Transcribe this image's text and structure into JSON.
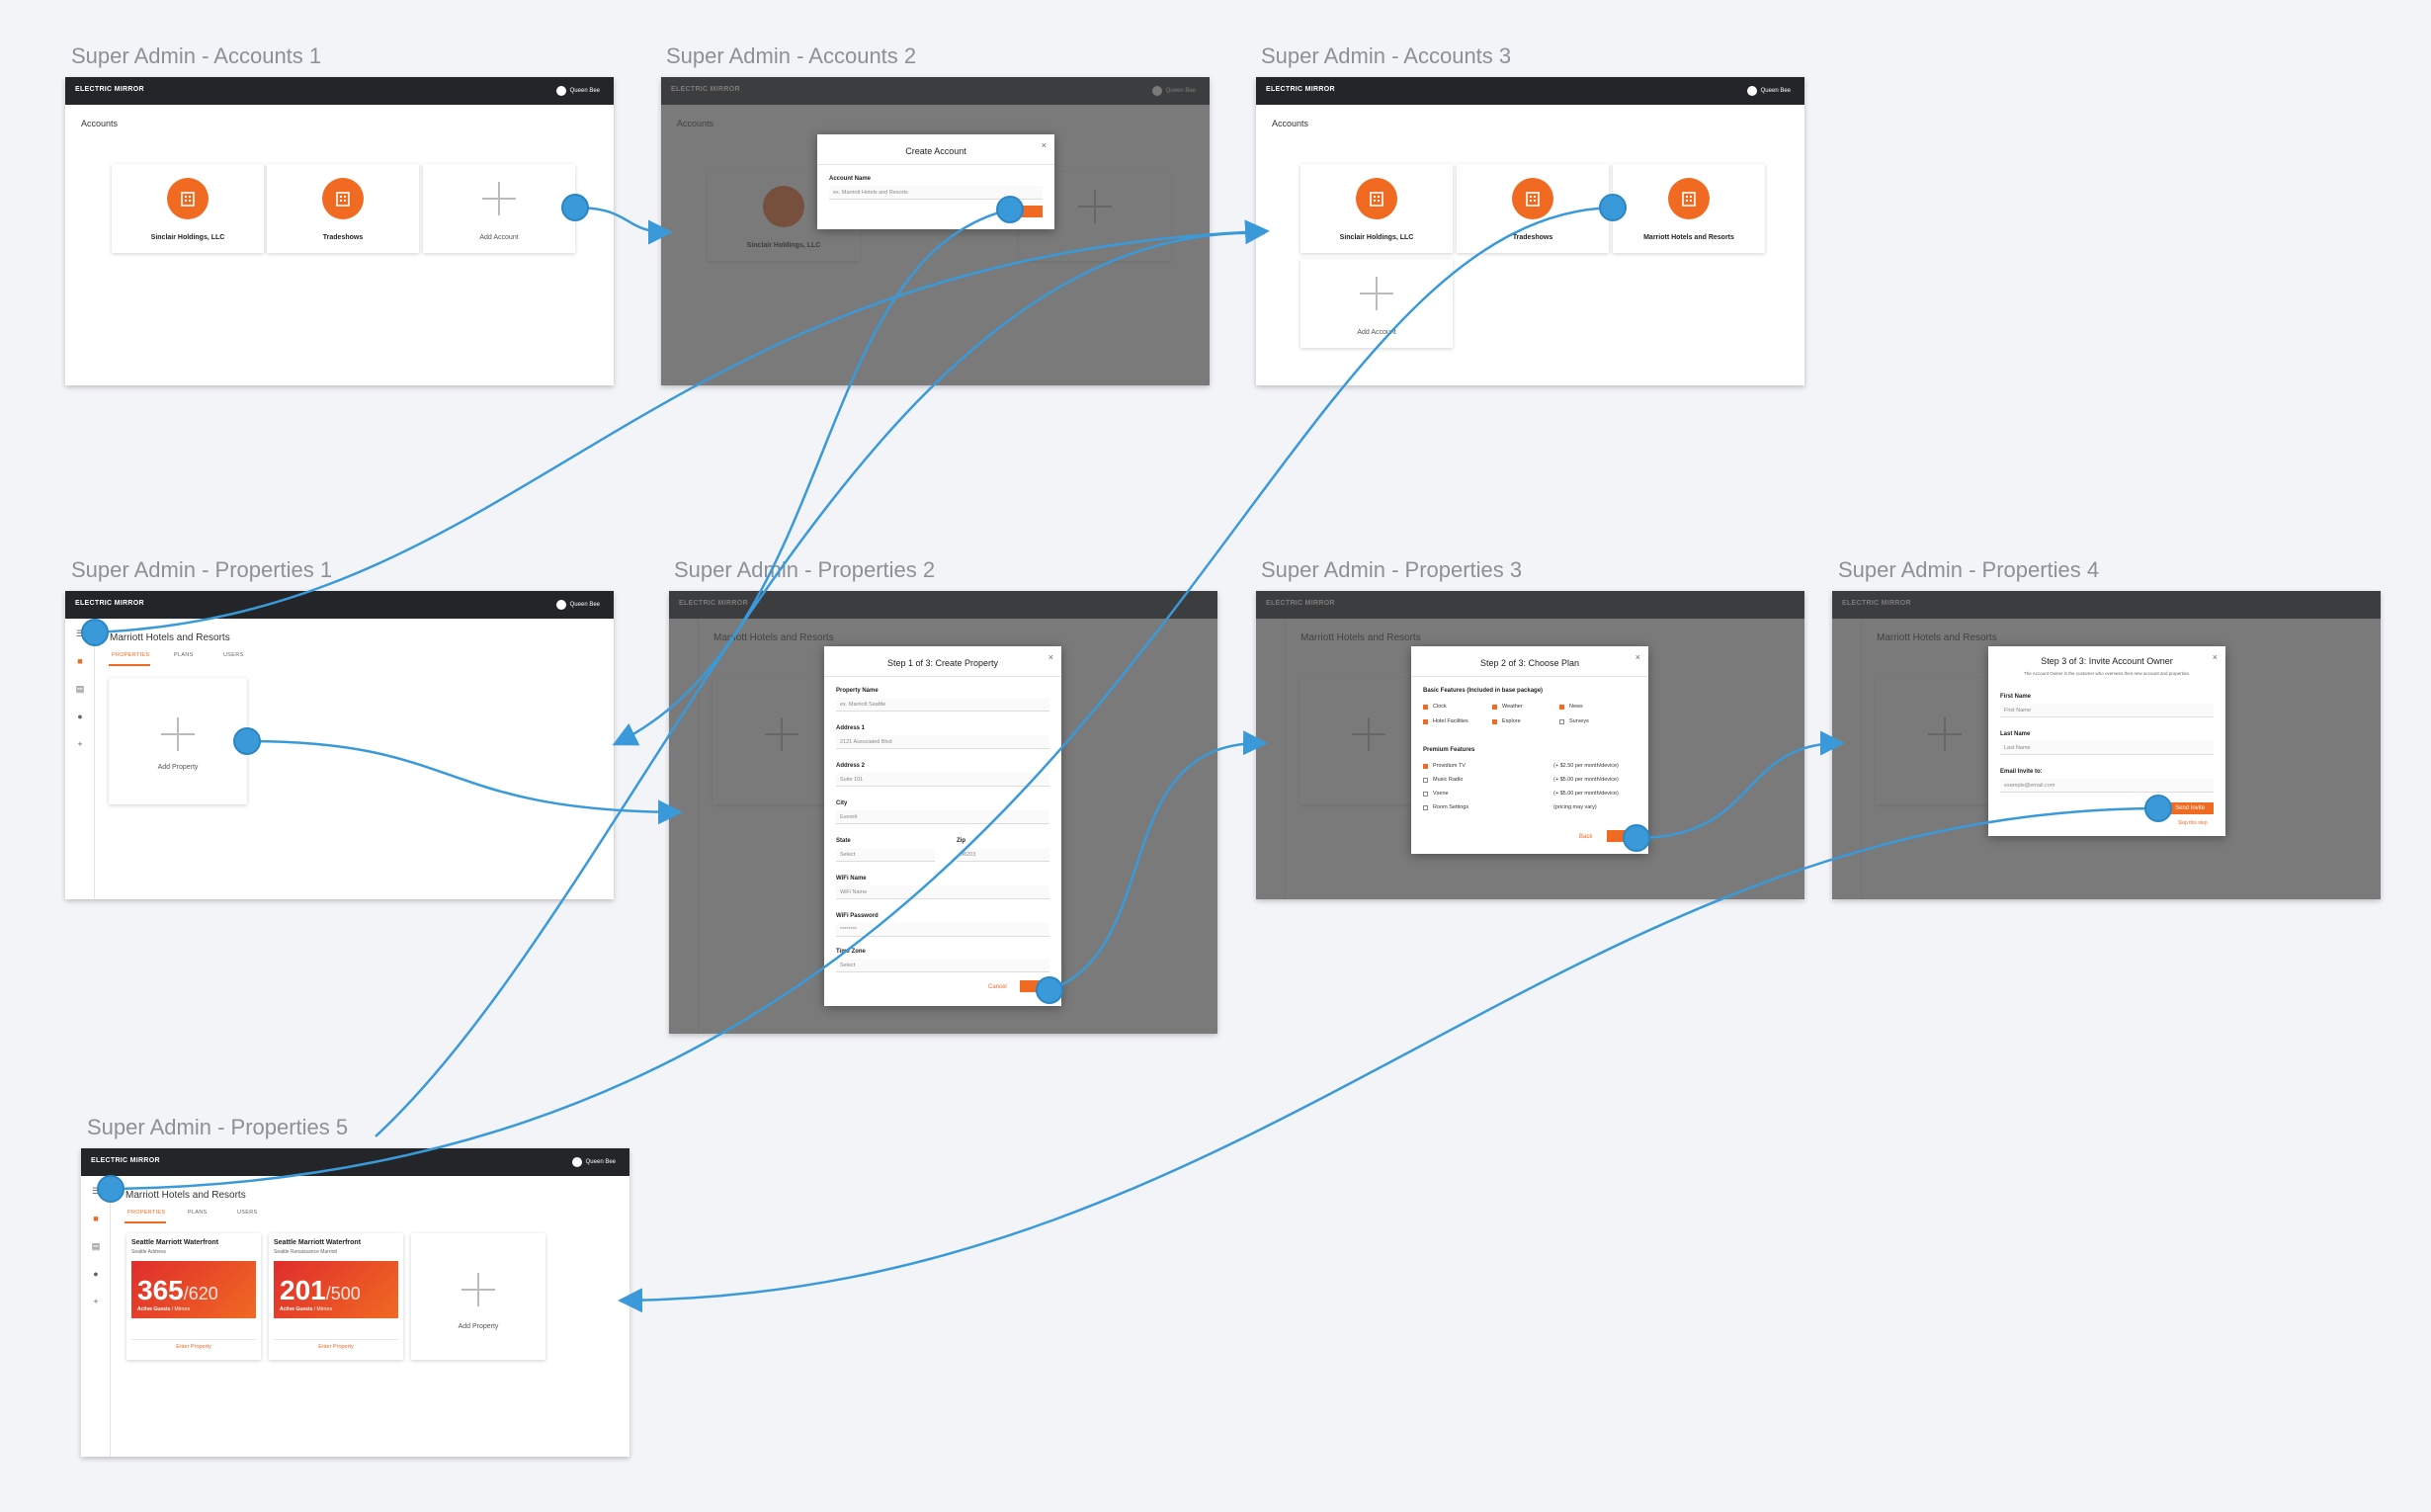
{
  "brand": "ELECTRIC MIRROR",
  "user_name": "Queen Bee",
  "frames": {
    "acc1": "Super Admin - Accounts 1",
    "acc2": "Super Admin - Accounts 2",
    "acc3": "Super Admin - Accounts 3",
    "prop1": "Super Admin - Properties 1",
    "prop2": "Super Admin - Properties 2",
    "prop3": "Super Admin - Properties 3",
    "prop4": "Super Admin - Properties 4",
    "prop5": "Super Admin - Properties 5"
  },
  "accounts": {
    "heading": "Accounts",
    "items": [
      "Sinclair Holdings, LLC",
      "Tradeshows",
      "Marriott Hotels and Resorts"
    ],
    "add_label": "Add Account"
  },
  "create_account": {
    "title": "Create Account",
    "field_label": "Account Name",
    "field_value": "ex. Marriott Hotels and Resorts"
  },
  "property_page": {
    "title": "Marriott Hotels and Resorts",
    "tabs": [
      "PROPERTIES",
      "PLANS",
      "USERS"
    ],
    "add_label": "Add Property"
  },
  "step1": {
    "title": "Step 1 of 3: Create Property",
    "fields": [
      {
        "label": "Property Name",
        "value": "ex. Marriott Seattle"
      },
      {
        "label": "Address 1",
        "value": "2121 Associated Blvd"
      },
      {
        "label": "Address 2",
        "value": "Suite 101"
      },
      {
        "label": "City",
        "value": "Everett"
      }
    ],
    "state_label": "State",
    "state_value": "Select",
    "zip_label": "Zip",
    "zip_value": "98203",
    "wifi_name_label": "WiFi Name",
    "wifi_name_value": "WiFi Name",
    "wifi_pass_label": "WiFi Password",
    "wifi_pass_value": "********",
    "tz_label": "Time Zone",
    "tz_value": "Select",
    "cancel": "Cancel"
  },
  "step2": {
    "title": "Step 2 of 3: Choose Plan",
    "basic_heading": "Basic Features (Included in base package)",
    "basic": [
      "Clock",
      "Weather",
      "News",
      "Hotel Facilities",
      "Explore",
      "Surveys"
    ],
    "premium_heading": "Premium Features",
    "premium": [
      {
        "name": "Providium TV",
        "price": "(+ $2.50 per month/device)"
      },
      {
        "name": "Music Radio",
        "price": "(+ $5.00 per month/device)"
      },
      {
        "name": "Vsene",
        "price": "(+ $5.00 per month/device)"
      },
      {
        "name": "Room Settings",
        "price": "(pricing may vary)"
      }
    ],
    "back": "Back"
  },
  "step3": {
    "title": "Step 3 of 3: Invite Account Owner",
    "subtitle": "The Account Owner is the customer who oversees their new account and properties.",
    "first_label": "First Name",
    "first_value": "First Name",
    "last_label": "Last Name",
    "last_value": "Last Name",
    "email_label": "Email Invite to:",
    "email_value": "example@email.com",
    "send": "Send Invite",
    "skip": "Skip this step"
  },
  "properties": [
    {
      "name": "Seattle Marriott Waterfront",
      "sub": "Seattle Address",
      "active": "365",
      "total": "/620",
      "caption": "Active Guests",
      "caption2": "/ Mirrors",
      "link": "Enter Property"
    },
    {
      "name": "Seattle Marriott Waterfront",
      "sub": "Seattle Renaissance Marriott",
      "active": "201",
      "total": "/500",
      "caption": "Active Guests",
      "caption2": "/ Mirrors",
      "link": "Enter Property"
    }
  ],
  "colors": {
    "accent": "#f06a22",
    "link": "#3a9ad9",
    "topbar": "#232529"
  }
}
